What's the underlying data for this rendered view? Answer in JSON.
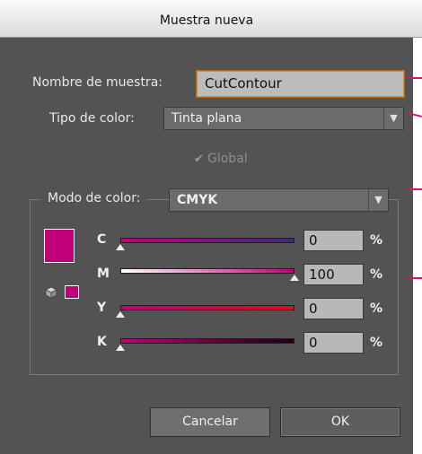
{
  "window": {
    "title": "Muestra nueva"
  },
  "form": {
    "name_label": "Nombre de muestra:",
    "name_value": "CutContour",
    "color_type_label": "Tipo de color:",
    "color_type_value": "Tinta plana",
    "global_label": "Global",
    "global_checked": true,
    "color_mode_label": "Modo de color:",
    "color_mode_value": "CMYK"
  },
  "swatch_color": "#c0007a",
  "channels": [
    {
      "label": "C",
      "value": "0",
      "unit": "%",
      "percent": 0
    },
    {
      "label": "M",
      "value": "100",
      "unit": "%",
      "percent": 100
    },
    {
      "label": "Y",
      "value": "0",
      "unit": "%",
      "percent": 0
    },
    {
      "label": "K",
      "value": "0",
      "unit": "%",
      "percent": 0
    }
  ],
  "buttons": {
    "cancel": "Cancelar",
    "ok": "OK"
  }
}
